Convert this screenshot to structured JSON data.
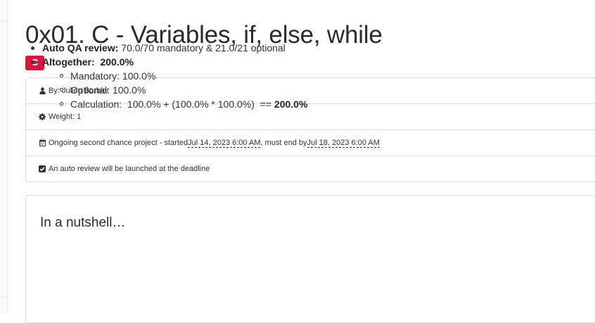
{
  "project": {
    "title": "0x01. C - Variables, if, else, while",
    "tag": "C"
  },
  "info": {
    "author": "By: Julien Barbier",
    "weight": "Weight: 1",
    "ongoing_prefix": "Ongoing second chance project - started ",
    "started_date": "Jul 14, 2023 6:00 AM",
    "ongoing_middle": ", must end by ",
    "end_date": "Jul 18, 2023 6:00 AM",
    "auto_review": "An auto review will be launched at the deadline"
  },
  "icons": {
    "author": "user-icon",
    "weight": "cog-icon",
    "calendar": "calendar-icon",
    "check": "checkbox-checked-icon"
  },
  "nutshell": {
    "heading": "In a nutshell…",
    "auto_qa_label": "Auto QA review:",
    "auto_qa_value": " 70.0/70 mandatory & 21.0/21 optional",
    "altogether_label": "Altogether:",
    "altogether_value": "200.0%",
    "mandatory": "Mandatory: 100.0%",
    "optional": "Optional: 100.0%",
    "calculation_prefix": "Calculation:  100.0% + (100.0% * 100.0%)  == ",
    "calculation_result": "200.0%"
  },
  "colors": {
    "tag_bg": "#d8163f",
    "text": "#333333",
    "border": "#dddddd"
  }
}
